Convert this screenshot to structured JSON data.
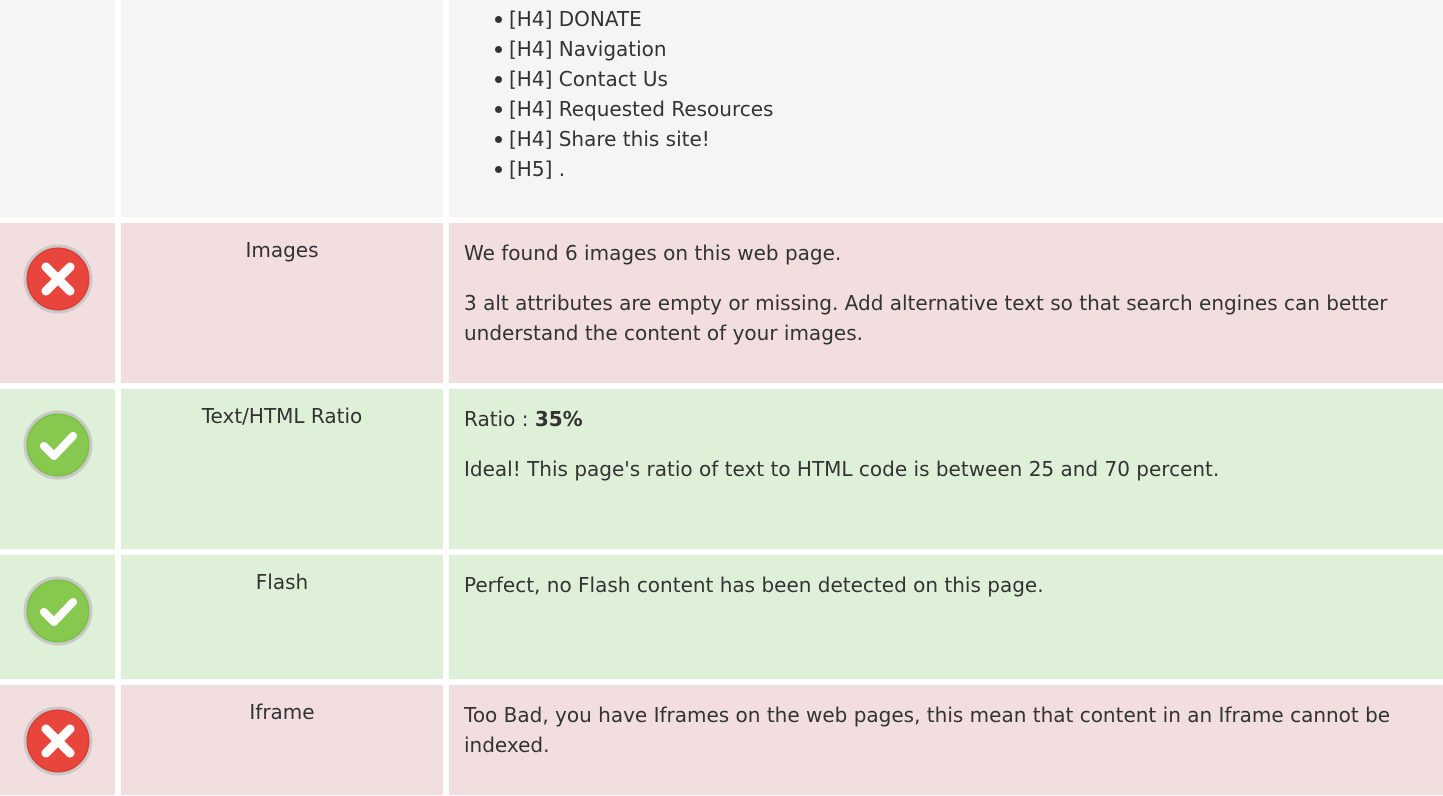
{
  "headings": {
    "items": [
      "[H4] DONATE",
      "[H4] Navigation",
      "[H4] Contact Us",
      "[H4] Requested Resources",
      "[H4] Share this site!",
      "[H5] ."
    ]
  },
  "images": {
    "label": "Images",
    "status": "error",
    "line1": "We found 6 images on this web page.",
    "line2": "3 alt attributes are empty or missing. Add alternative text so that search engines can better understand the content of your images."
  },
  "ratio": {
    "label": "Text/HTML Ratio",
    "status": "ok",
    "prefix": "Ratio : ",
    "value": "35%",
    "line2": "Ideal! This page's ratio of text to HTML code is between 25 and 70 percent."
  },
  "flash": {
    "label": "Flash",
    "status": "ok",
    "line1": "Perfect, no Flash content has been detected on this page."
  },
  "iframe": {
    "label": "Iframe",
    "status": "error",
    "line1": "Too Bad, you have Iframes on the web pages, this mean that content in an Iframe cannot be indexed."
  },
  "icons": {
    "error": "error-x-icon",
    "ok": "check-ok-icon"
  },
  "colors": {
    "error_bg": "#f2dede",
    "ok_bg": "#dff0d8",
    "neutral_bg": "#f5f5f5",
    "error_icon": "#e03b34",
    "ok_icon": "#7ac043"
  }
}
